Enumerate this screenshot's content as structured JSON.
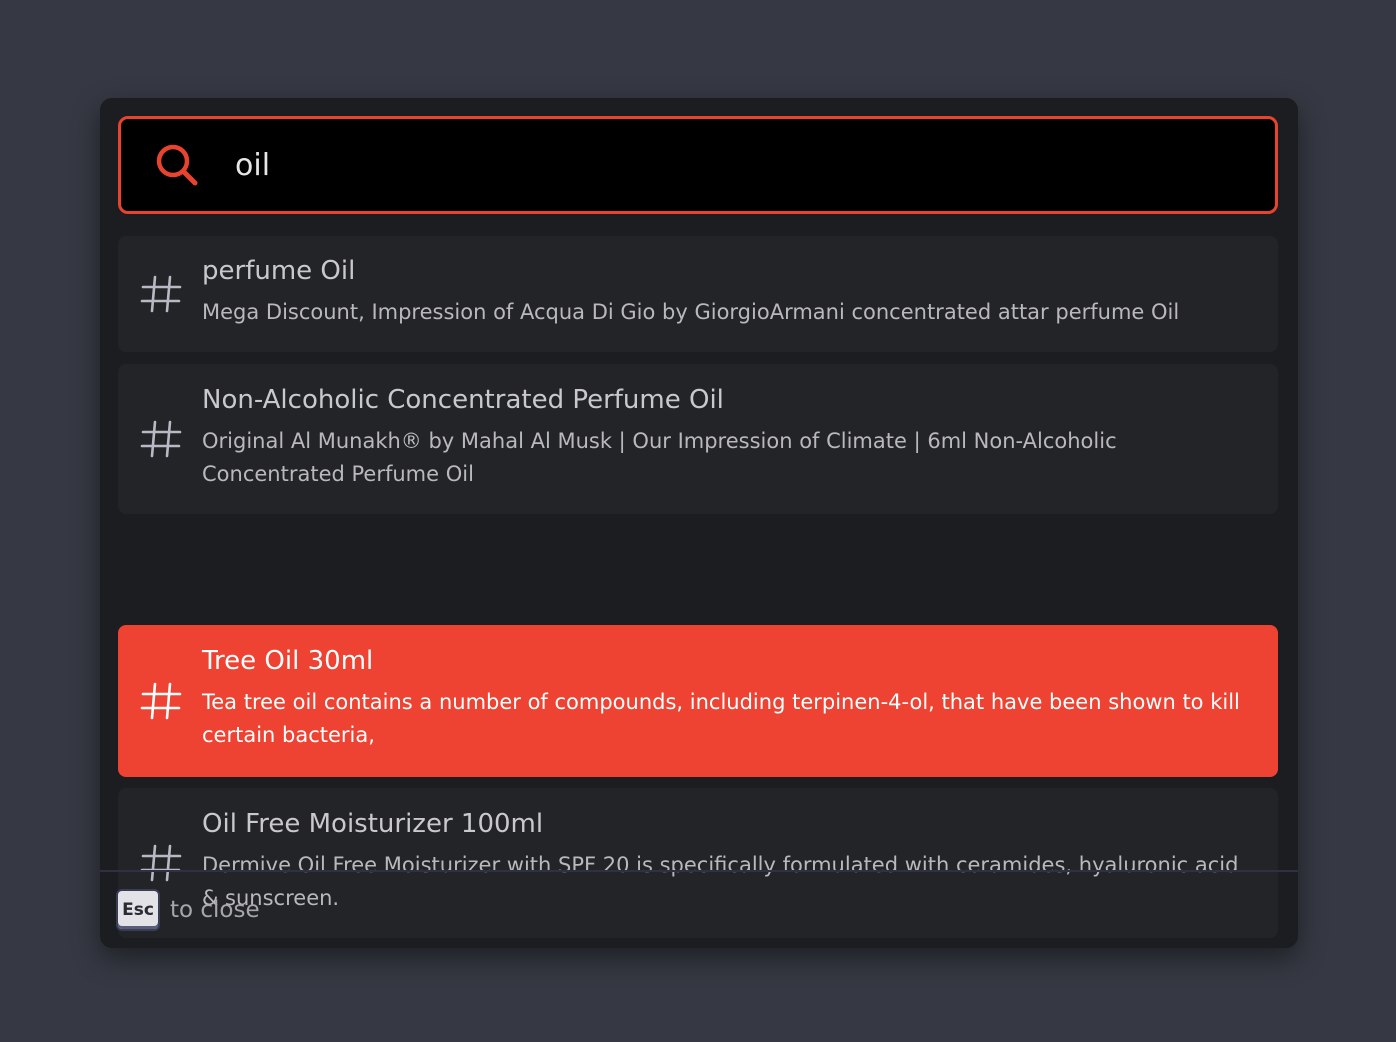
{
  "search": {
    "value": "oil",
    "icon": "search-icon",
    "accent_color": "#e8432f"
  },
  "results": [
    {
      "icon": "hash-icon",
      "title": "perfume Oil",
      "description": "Mega Discount, Impression of Acqua Di Gio by GiorgioArmani concentrated attar perfume Oil",
      "active": false
    },
    {
      "icon": "hash-icon",
      "title": "Non-Alcoholic Concentrated Perfume Oil",
      "description": "Original Al Munakh® by Mahal Al Musk | Our Impression of Climate | 6ml Non-Alcoholic Concentrated Perfume Oil",
      "active": false
    },
    {
      "icon": "hash-icon",
      "title": "Tree Oil 30ml",
      "description": "Tea tree oil contains a number of compounds, including terpinen-4-ol, that have been shown to kill certain bacteria,",
      "active": true
    },
    {
      "icon": "hash-icon",
      "title": "Oil Free Moisturizer 100ml",
      "description": "Dermive Oil Free Moisturizer with SPF 20 is specifically formulated with ceramides, hyaluronic acid & sunscreen.",
      "active": false
    }
  ],
  "footer": {
    "key_label": "Esc",
    "text": "to close"
  },
  "colors": {
    "active_row": "#ee4232",
    "row_bg": "#232428",
    "modal_bg": "#1c1d21",
    "page_bg": "#363943"
  }
}
